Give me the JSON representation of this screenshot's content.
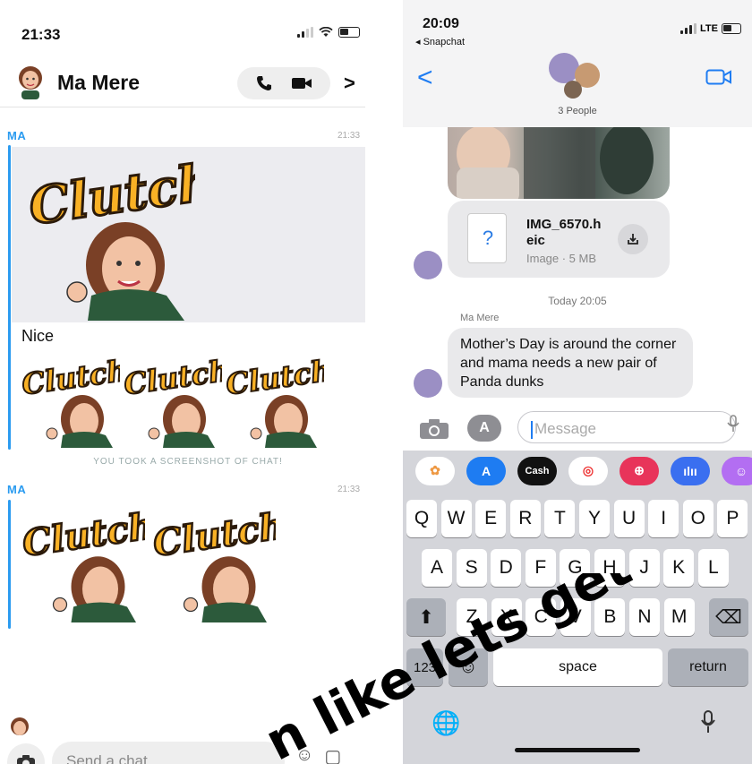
{
  "snapchat": {
    "status_time": "21:33",
    "contact_name": "Ma Mere",
    "messages": [
      {
        "sender": "MA",
        "time": "21:33",
        "sticker_text": "Clutch",
        "text": "Nice",
        "sticker_count": 3
      },
      {
        "sender": "MA",
        "time": "21:33",
        "sticker_text": "Clutch",
        "sticker_count": 2
      }
    ],
    "screenshot_notice": "YOU TOOK A SCREENSHOT OF CHAT!",
    "input_placeholder": "Send a chat"
  },
  "imessage": {
    "status_time": "20:09",
    "back_app": "◂ Snapchat",
    "network": "LTE",
    "group_label": "3 People",
    "attachment": {
      "name": "IMG_6570.heic",
      "name_line1": "IMG_6570.h",
      "name_line2": "eic",
      "meta": "Image · 5 MB"
    },
    "date_label": "Today 20:05",
    "sender_label": "Ma Mere",
    "message_text": "Mother’s Day is around the corner and mama needs a new pair of Panda dunks",
    "input_placeholder": "Message",
    "apps": [
      "photos",
      "app-store",
      "cash",
      "fitness",
      "search",
      "audio",
      "memoji"
    ],
    "cash_label": "Cash",
    "keyboard": {
      "row1": [
        "Q",
        "W",
        "E",
        "R",
        "T",
        "Y",
        "U",
        "I",
        "O",
        "P"
      ],
      "row2": [
        "A",
        "S",
        "D",
        "F",
        "G",
        "H",
        "J",
        "K",
        "L"
      ],
      "row3": [
        "Z",
        "X",
        "C",
        "V",
        "B",
        "N",
        "M"
      ],
      "numbers_key": "123",
      "space_key": "space",
      "return_key": "return"
    }
  },
  "overlay_caption": "n like lets get bread th",
  "colors": {
    "snap_blue": "#2a9bf0",
    "ios_blue": "#1e7cf2",
    "clutch_gold": "#f9b125"
  }
}
